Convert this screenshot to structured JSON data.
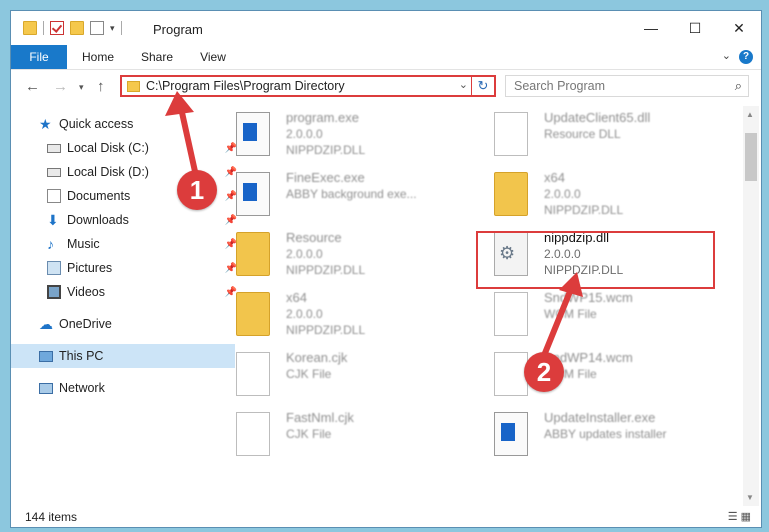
{
  "window": {
    "title": "Program"
  },
  "ribbon": {
    "tabs": [
      "File",
      "Home",
      "Share",
      "View"
    ],
    "help": "?"
  },
  "address": {
    "path": "C:\\Program Files\\Program Directory",
    "search_placeholder": "Search Program"
  },
  "sidebar": {
    "items": [
      {
        "label": "Quick access",
        "icon": "star-icon",
        "pinned": false
      },
      {
        "label": "Local Disk (C:)",
        "icon": "drive-icon",
        "pinned": true
      },
      {
        "label": "Local Disk (D:)",
        "icon": "drive-icon",
        "pinned": true
      },
      {
        "label": "Documents",
        "icon": "documents-icon",
        "pinned": true
      },
      {
        "label": "Downloads",
        "icon": "download-icon",
        "pinned": true
      },
      {
        "label": "Music",
        "icon": "music-icon",
        "pinned": true
      },
      {
        "label": "Pictures",
        "icon": "pictures-icon",
        "pinned": true
      },
      {
        "label": "Videos",
        "icon": "videos-icon",
        "pinned": true
      },
      {
        "label": "OneDrive",
        "icon": "onedrive-icon",
        "pinned": false
      },
      {
        "label": "This PC",
        "icon": "pc-icon",
        "pinned": false
      },
      {
        "label": "Network",
        "icon": "network-icon",
        "pinned": false
      }
    ]
  },
  "files": [
    {
      "name": "program.exe",
      "line2": "2.0.0.0",
      "line3": "NIPPDZIP.DLL",
      "icon": "exe-icon"
    },
    {
      "name": "UpdateClient65.dll",
      "line2": "Resource DLL",
      "line3": "",
      "icon": "dll-icon"
    },
    {
      "name": "FineExec.exe",
      "line2": "ABBY background exe...",
      "line3": "",
      "icon": "exe-icon"
    },
    {
      "name": "x64",
      "line2": "2.0.0.0",
      "line3": "NIPPDZIP.DLL",
      "icon": "folder-icon"
    },
    {
      "name": "Resource",
      "line2": "2.0.0.0",
      "line3": "NIPPDZIP.DLL",
      "icon": "folder-icon"
    },
    {
      "name": "nippdzip.dll",
      "line2": "2.0.0.0",
      "line3": "NIPPDZIP.DLL",
      "icon": "dll-gear-icon"
    },
    {
      "name": "x64",
      "line2": "2.0.0.0",
      "line3": "NIPPDZIP.DLL",
      "icon": "folder-icon"
    },
    {
      "name": "SndWP15.wcm",
      "line2": "WCM File",
      "line3": "",
      "icon": "file-icon"
    },
    {
      "name": "Korean.cjk",
      "line2": "CJK File",
      "line3": "",
      "icon": "file-icon"
    },
    {
      "name": "SndWP14.wcm",
      "line2": "WCM File",
      "line3": "",
      "icon": "file-icon"
    },
    {
      "name": "FastNml.cjk",
      "line2": "CJK File",
      "line3": "",
      "icon": "file-icon"
    },
    {
      "name": "UpdateInstaller.exe",
      "line2": "ABBY updates installer",
      "line3": "",
      "icon": "exe-icon"
    }
  ],
  "annotations": [
    "1",
    "2"
  ],
  "status": {
    "count": "144 items"
  },
  "colors": {
    "accent": "#1979ca",
    "highlight": "#dc3c3c",
    "selected": "#cce4f7"
  }
}
